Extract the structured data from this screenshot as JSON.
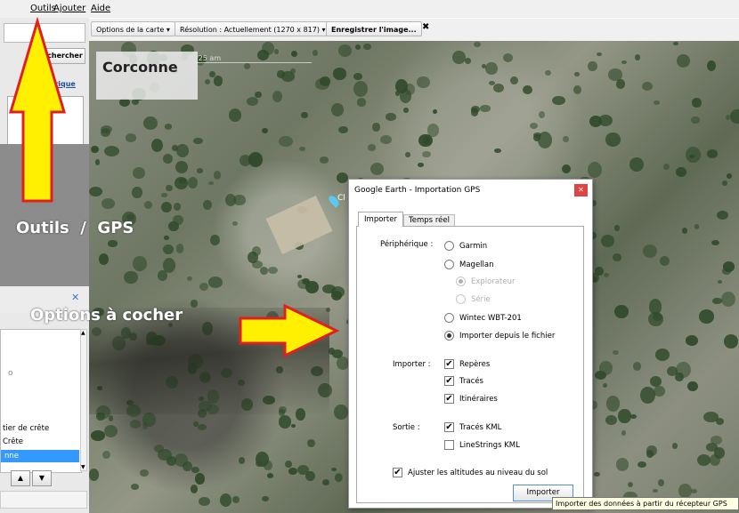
{
  "menu": {
    "items": [
      "Outils",
      "Ajouter",
      "Aide"
    ]
  },
  "toolbar": {
    "map_options": "Options de la carte ▾",
    "resolution": "Résolution : Actuellement (1270 x 817) ▾",
    "save_image": "Enregistrer l'image...",
    "close": "✖"
  },
  "sidebar": {
    "search_button": "chercher",
    "history_link": "torique",
    "panel_close": "✕",
    "list_items": [
      "tier de crête",
      "Crête",
      "nne"
    ],
    "list_small_text": "o",
    "nav_up": "▲",
    "nav_down": "▼"
  },
  "map": {
    "place_title": "Corconne",
    "time_label": ":25 am"
  },
  "annotations": {
    "outils_gps": "Outils  /  GPS",
    "options_a_cocher": "Options à cocher",
    "pin_label": "Cl"
  },
  "dialog": {
    "title": "Google Earth - Importation GPS",
    "close": "✕",
    "tabs": [
      "Importer",
      "Temps réel"
    ],
    "peripheral_label": "Périphérique :",
    "devices": [
      {
        "label": "Garmin",
        "checked": false,
        "disabled": false
      },
      {
        "label": "Magellan",
        "checked": false,
        "disabled": false
      },
      {
        "label": "Explorateur",
        "checked": true,
        "disabled": true
      },
      {
        "label": "Série",
        "checked": false,
        "disabled": true
      },
      {
        "label": "Wintec WBT-201",
        "checked": false,
        "disabled": false
      },
      {
        "label": "Importer depuis le fichier",
        "checked": true,
        "disabled": false
      }
    ],
    "import_label": "Importer :",
    "import_options": [
      "Repères",
      "Tracés",
      "Itinéraires"
    ],
    "output_label": "Sortie :",
    "output_options": [
      {
        "label": "Tracés KML",
        "checked": true
      },
      {
        "label": "LineStrings KML",
        "checked": false
      }
    ],
    "adjust_altitude": "Ajuster les altitudes au niveau du sol",
    "import_button": "Importer",
    "tooltip": "Importer des données à partir du récepteur GPS"
  },
  "colors": {
    "arrow_yellow": "#ffef00",
    "arrow_red": "#e02020",
    "dialog_close": "#e04343",
    "selection_blue": "#3399ff"
  }
}
